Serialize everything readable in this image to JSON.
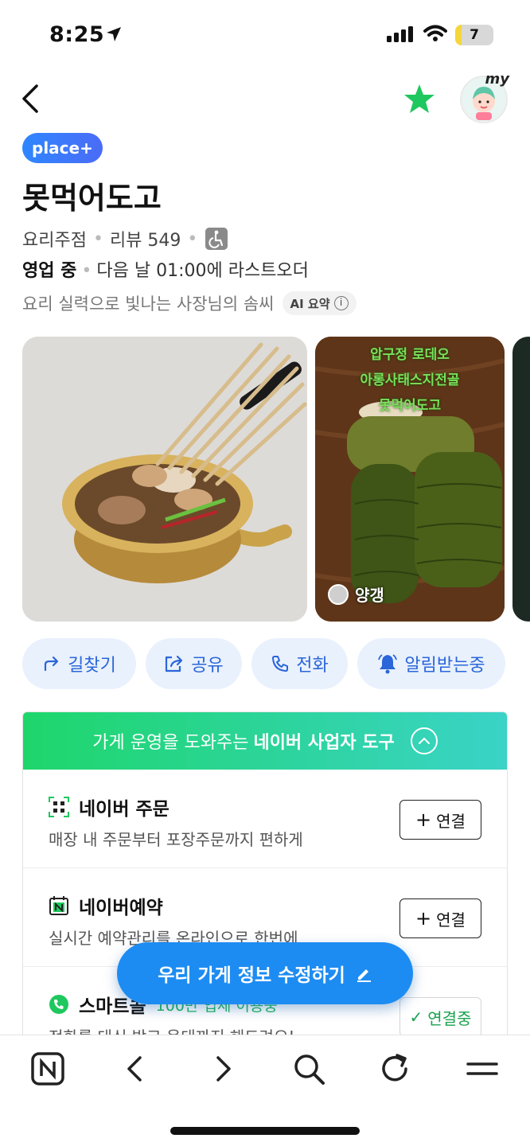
{
  "status_bar": {
    "time": "8:25",
    "battery": "7"
  },
  "header": {
    "avatar_label": "my"
  },
  "place": {
    "badge": "place+",
    "name": "못먹어도고",
    "category": "요리주점",
    "review_label": "리뷰 549",
    "hours_status": "영업 중",
    "hours_detail": "다음 날 01:00에 라스트오더",
    "summary": "요리 실력으로 빛나는 사장님의 솜씨",
    "ai_label": "AI 요약"
  },
  "photos": {
    "caption_lines": [
      "압구정 로데오",
      "아롱사태스지전골",
      "못먹어도고"
    ],
    "reviewer": "양갱"
  },
  "actions": [
    {
      "label": "길찾기",
      "icon": "directions-icon"
    },
    {
      "label": "공유",
      "icon": "share-icon"
    },
    {
      "label": "전화",
      "icon": "phone-icon"
    },
    {
      "label": "알림받는중",
      "icon": "bell-icon"
    }
  ],
  "tools": {
    "header_prefix": "가게 운영을 도와주는",
    "header_bold": "네이버 사업자 도구",
    "rows": [
      {
        "title": "네이버 주문",
        "subtitle": "매장 내 주문부터 포장주문까지 편하게",
        "button": "연결"
      },
      {
        "title": "네이버예약",
        "subtitle": "실시간 예약관리를 온라인으로 한번에",
        "button": "연결"
      },
      {
        "title": "스마트콜",
        "note": "100만 업체 이용중",
        "subtitle": "전화를 대신 받고 응대까지 해드려요!",
        "button": "연결중"
      }
    ]
  },
  "fab": {
    "label": "우리 가게 정보 수정하기"
  },
  "colors": {
    "accent": "#1d8cf2",
    "green": "#1ec85e",
    "action_bg": "#e9f1fd",
    "action_text": "#2a66d9"
  }
}
